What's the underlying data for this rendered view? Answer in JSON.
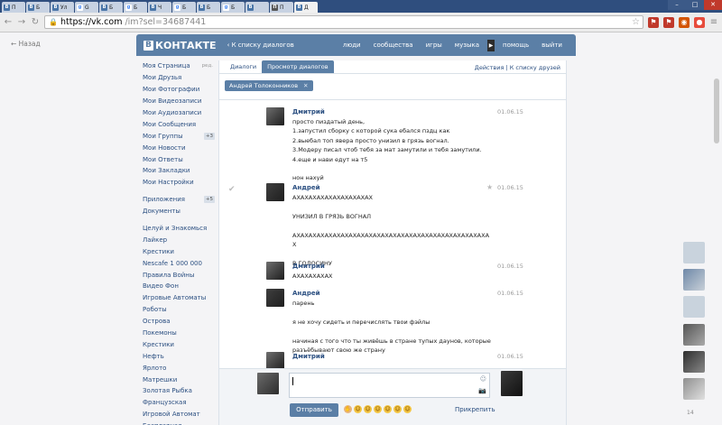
{
  "browser": {
    "tabs": [
      {
        "icon": "В",
        "label": "П",
        "active": false
      },
      {
        "icon": "В",
        "label": "Б",
        "active": false
      },
      {
        "icon": "В",
        "label": "Ул",
        "active": false
      },
      {
        "icon": "g",
        "label": "G",
        "active": false
      },
      {
        "icon": "В",
        "label": "Б",
        "active": false
      },
      {
        "icon": "g",
        "label": "Б",
        "active": false
      },
      {
        "icon": "В",
        "label": "Ч",
        "active": false
      },
      {
        "icon": "g",
        "label": "Б",
        "active": false
      },
      {
        "icon": "В",
        "label": "Б",
        "active": false
      },
      {
        "icon": "g",
        "label": "Б",
        "active": false
      },
      {
        "icon": "В",
        "label": "",
        "active": false
      },
      {
        "icon": "П",
        "label": "П",
        "active": false
      },
      {
        "icon": "В",
        "label": "Д",
        "active": true
      }
    ],
    "url_host": "https://vk.com",
    "url_path": "/im?sel=34687441",
    "back": "Назад"
  },
  "header": {
    "logo_letter": "В",
    "logo_text": "КОНТАКТЕ",
    "back_to_dialogs": "К списку диалогов",
    "nav": [
      "люди",
      "сообщества",
      "игры",
      "музыка"
    ],
    "play": "▶",
    "help": "помощь",
    "logout": "выйти"
  },
  "left_nav": {
    "edit": "ред.",
    "main": [
      {
        "label": "Моя Страница"
      },
      {
        "label": "Мои Друзья"
      },
      {
        "label": "Мои Фотографии"
      },
      {
        "label": "Мои Видеозаписи"
      },
      {
        "label": "Мои Аудиозаписи"
      },
      {
        "label": "Мои Сообщения"
      },
      {
        "label": "Мои Группы",
        "badge": "+3"
      },
      {
        "label": "Мои Новости"
      },
      {
        "label": "Мои Ответы"
      },
      {
        "label": "Мои Закладки"
      },
      {
        "label": "Мои Настройки"
      }
    ],
    "apps_section": [
      {
        "label": "Приложения",
        "badge": "+5"
      },
      {
        "label": "Документы"
      }
    ],
    "games": [
      "Целуй и Знакомься",
      "Лайкер",
      "Крестики",
      "Nescafe 1 000 000",
      "Правила Войны",
      "Видео Фон",
      "Игровые Автоматы",
      "Роботы",
      "Острова",
      "Покемоны",
      "Крестики",
      "Нефть",
      "Ярлото",
      "Матрешки",
      "Золотая Рыбка",
      "Французская",
      "Игровой Автомат",
      "Бесплатная"
    ]
  },
  "content": {
    "tabs": [
      "Диалоги",
      "Просмотр диалогов"
    ],
    "active_tab": 1,
    "right_links": "Действия  |  К списку друзей",
    "recipient": "Андрей Толоконников",
    "recipient_close": "✕"
  },
  "messages": [
    {
      "author": "Дмитрий",
      "date": "01.06.15",
      "text": "просто пиздатый день,\n1.запустил сборку с которой сука ебался пздц как\n2.выебал топ явера просто унизил в грязь вогнал.\n3.Модеру писал чтоб тебя за мат замутили и тебя замутили.\n4.еще и нави едут на т5\n\nнон нахуй"
    },
    {
      "author": "Андрей",
      "date": "01.06.15",
      "text": "АХАХАХАХАХАХАХАХАХАХ\n\nУНИЗИЛ В ГРЯЗЬ ВОГНАЛ\n\nАХАХАХАХАХАХАХАХАХАХАХАХАХАХАХАХАХАХАХАХАХАХАХАХА\nХ\n\nВ ГОЛОСИНУ"
    },
    {
      "author": "Дмитрий",
      "date": "01.06.15",
      "text": "АХАХАХАХАХ"
    },
    {
      "author": "Андрей",
      "date": "01.06.15",
      "text": "парень\n\nя не хочу сидеть и перечислять твои фэйлы\n\nначиная с того что ты живёшь в стране тупых даунов, которые\nразъёбывают свою же страну"
    },
    {
      "author": "Дмитрий",
      "date": "01.06.15",
      "text": ""
    }
  ],
  "compose": {
    "send": "Отправить",
    "attach": "Прикрепить",
    "emoji_icon": "☺",
    "camera_icon": "📷"
  },
  "dock_count": "14",
  "colors": {
    "vk_blue": "#5b7fa6",
    "link": "#2b4f81",
    "chrome_tabbar": "#2f4e7e"
  }
}
